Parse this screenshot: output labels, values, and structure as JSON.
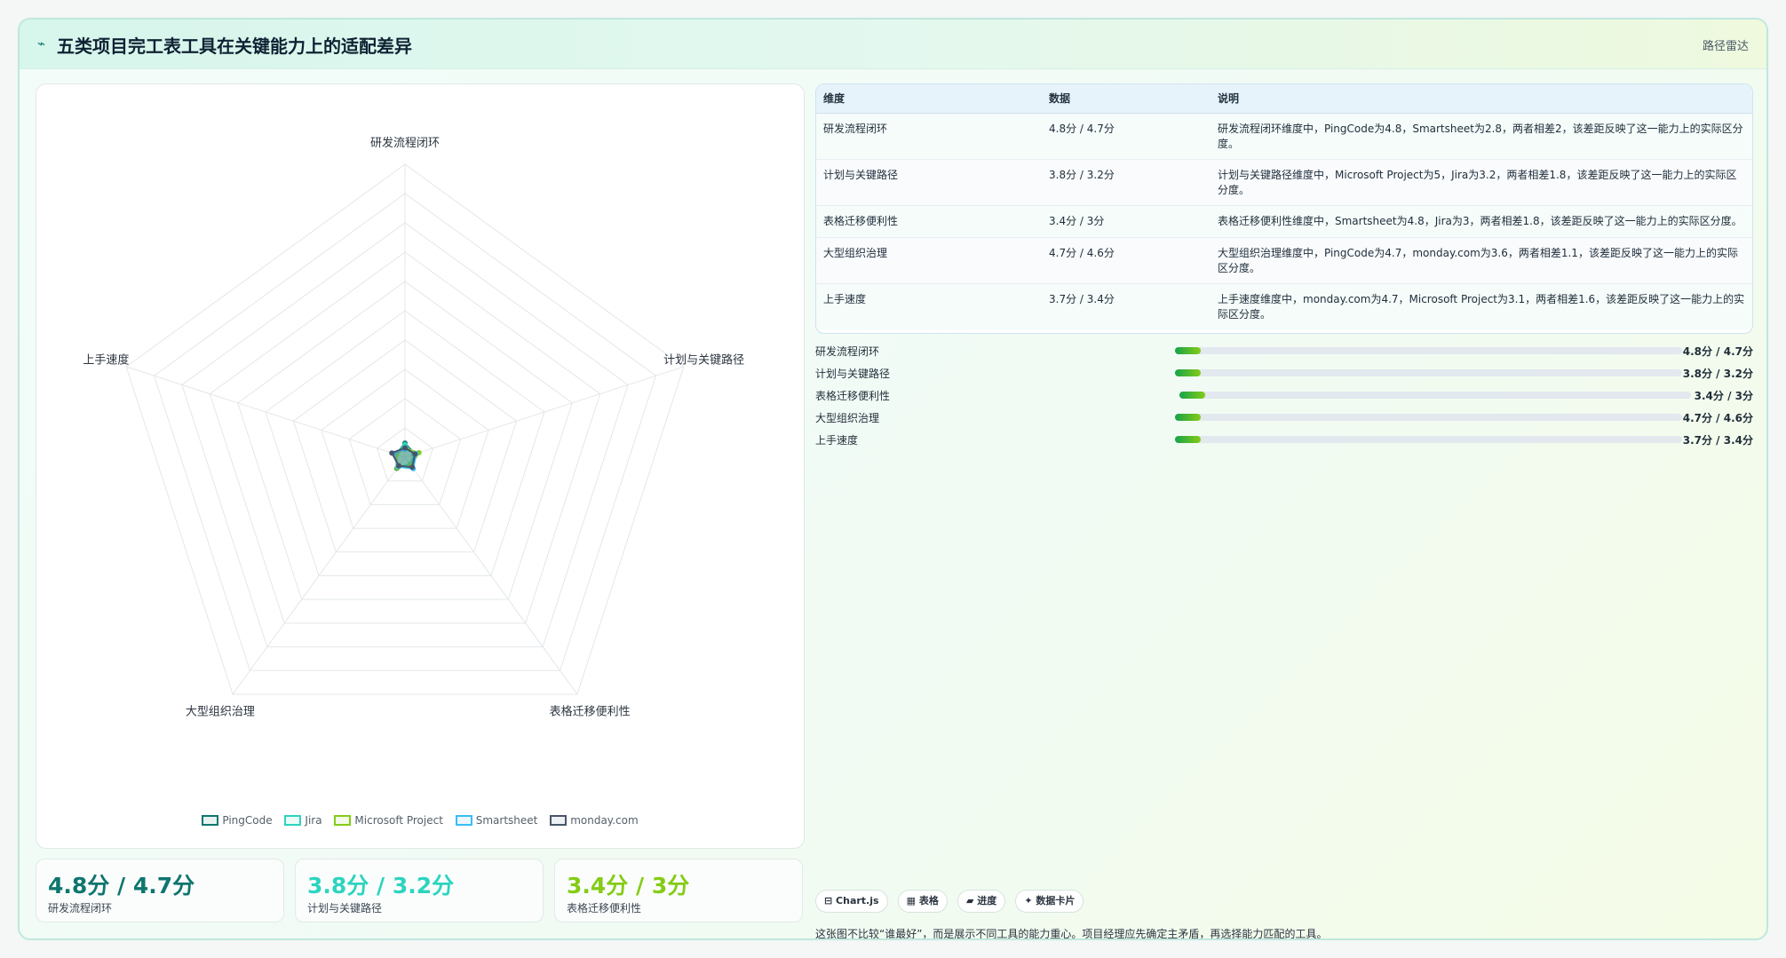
{
  "header": {
    "icon": "chart-icon",
    "title": "五类项目完工表工具在关键能力上的适配差异",
    "tag": "路径雷达"
  },
  "colors": {
    "PingCode": "#0f766e",
    "Jira": "#2dd4bf",
    "Microsoft Project": "#84cc16",
    "Smartsheet": "#38bdf8",
    "monday.com": "#475569"
  },
  "chart_data": {
    "type": "radar",
    "axes": [
      "研发流程闭环",
      "计划与关键路径",
      "表格迁移便利性",
      "大型组织治理",
      "上手速度"
    ],
    "rmax": 100,
    "grid_levels": 10,
    "series": [
      {
        "name": "PingCode",
        "values": [
          4.8,
          3.5,
          3.0,
          4.7,
          3.2
        ]
      },
      {
        "name": "Jira",
        "values": [
          4.3,
          3.2,
          3.0,
          4.2,
          3.4
        ]
      },
      {
        "name": "Microsoft Project",
        "values": [
          3.0,
          5.0,
          3.5,
          4.5,
          3.1
        ]
      },
      {
        "name": "Smartsheet",
        "values": [
          2.8,
          4.0,
          4.8,
          4.0,
          4.0
        ]
      },
      {
        "name": "monday.com",
        "values": [
          3.2,
          3.6,
          4.2,
          3.6,
          4.7
        ]
      }
    ],
    "legend": [
      "PingCode",
      "Jira",
      "Microsoft Project",
      "Smartsheet",
      "monday.com"
    ],
    "legend_position": "bottom"
  },
  "kpis": [
    {
      "value": "4.8分 / 4.7分",
      "label": "研发流程闭环",
      "color": "#0f766e"
    },
    {
      "value": "3.8分 / 3.2分",
      "label": "计划与关键路径",
      "color": "#2dd4bf"
    },
    {
      "value": "3.4分 / 3分",
      "label": "表格迁移便利性",
      "color": "#84cc16"
    }
  ],
  "table": {
    "headers": [
      "维度",
      "数据",
      "说明"
    ],
    "rows": [
      {
        "dim": "研发流程闭环",
        "data": "4.8分 / 4.7分",
        "note": "研发流程闭环维度中，PingCode为4.8，Smartsheet为2.8，两者相差2，该差距反映了这一能力上的实际区分度。"
      },
      {
        "dim": "计划与关键路径",
        "data": "3.8分 / 3.2分",
        "note": "计划与关键路径维度中，Microsoft Project为5，Jira为3.2，两者相差1.8，该差距反映了这一能力上的实际区分度。"
      },
      {
        "dim": "表格迁移便利性",
        "data": "3.4分 / 3分",
        "note": "表格迁移便利性维度中，Smartsheet为4.8，Jira为3，两者相差1.8，该差距反映了这一能力上的实际区分度。"
      },
      {
        "dim": "大型组织治理",
        "data": "4.7分 / 4.6分",
        "note": "大型组织治理维度中，PingCode为4.7，monday.com为3.6，两者相差1.1，该差距反映了这一能力上的实际区分度。"
      },
      {
        "dim": "上手速度",
        "data": "3.7分 / 3.4分",
        "note": "上手速度维度中，monday.com为4.7，Microsoft Project为3.1，两者相差1.6，该差距反映了这一能力上的实际区分度。"
      }
    ]
  },
  "bars": [
    {
      "label": "研发流程闭环",
      "value": "4.8分 / 4.7分",
      "fill": 0.05
    },
    {
      "label": "计划与关键路径",
      "value": "3.8分 / 3.2分",
      "fill": 0.05
    },
    {
      "label": "表格迁移便利性",
      "value": "3.4分 / 3分",
      "fill": 0.05
    },
    {
      "label": "大型组织治理",
      "value": "4.7分 / 4.6分",
      "fill": 0.05
    },
    {
      "label": "上手速度",
      "value": "3.7分 / 3.4分",
      "fill": 0.05
    }
  ],
  "chips": [
    "⊟ Chart.js",
    "▦ 表格",
    "▰ 进度",
    "✦ 数据卡片"
  ],
  "footnote": "这张图不比较“谁最好”，而是展示不同工具的能力重心。项目经理应先确定主矛盾，再选择能力匹配的工具。"
}
